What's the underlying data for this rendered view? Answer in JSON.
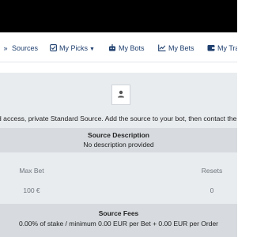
{
  "nav": {
    "items": [
      {
        "label": "Sources",
        "icon": "double-chevron-right-icon"
      },
      {
        "label": "My Picks",
        "icon": "checkbox-icon",
        "caret": "chevron-down-icon"
      },
      {
        "label": "My Bots",
        "icon": "robot-icon"
      },
      {
        "label": "My Bets",
        "icon": "chart-line-icon"
      },
      {
        "label": "My Tra",
        "icon": "wallet-icon"
      }
    ]
  },
  "source": {
    "avatar_icon": "user-icon",
    "access_text": "d access, private Standard Source. Add the source to your bot, then contact the"
  },
  "description": {
    "title": "Source Description",
    "text": "No description provided"
  },
  "stats": {
    "max_bet_label": "Max Bet",
    "max_bet_value": "100 €",
    "resets_label": "Resets",
    "resets_value": "0"
  },
  "fees": {
    "title": "Source Fees",
    "text": "0.00% of stake / minimum 0.00 EUR per Bet + 0.00 EUR per Order"
  },
  "colors": {
    "topbar": "#000000",
    "nav_text": "#1f3f6e",
    "content_bg": "#e9ecef",
    "band_bg": "#d7dbdf",
    "muted_text": "#6c757d"
  }
}
